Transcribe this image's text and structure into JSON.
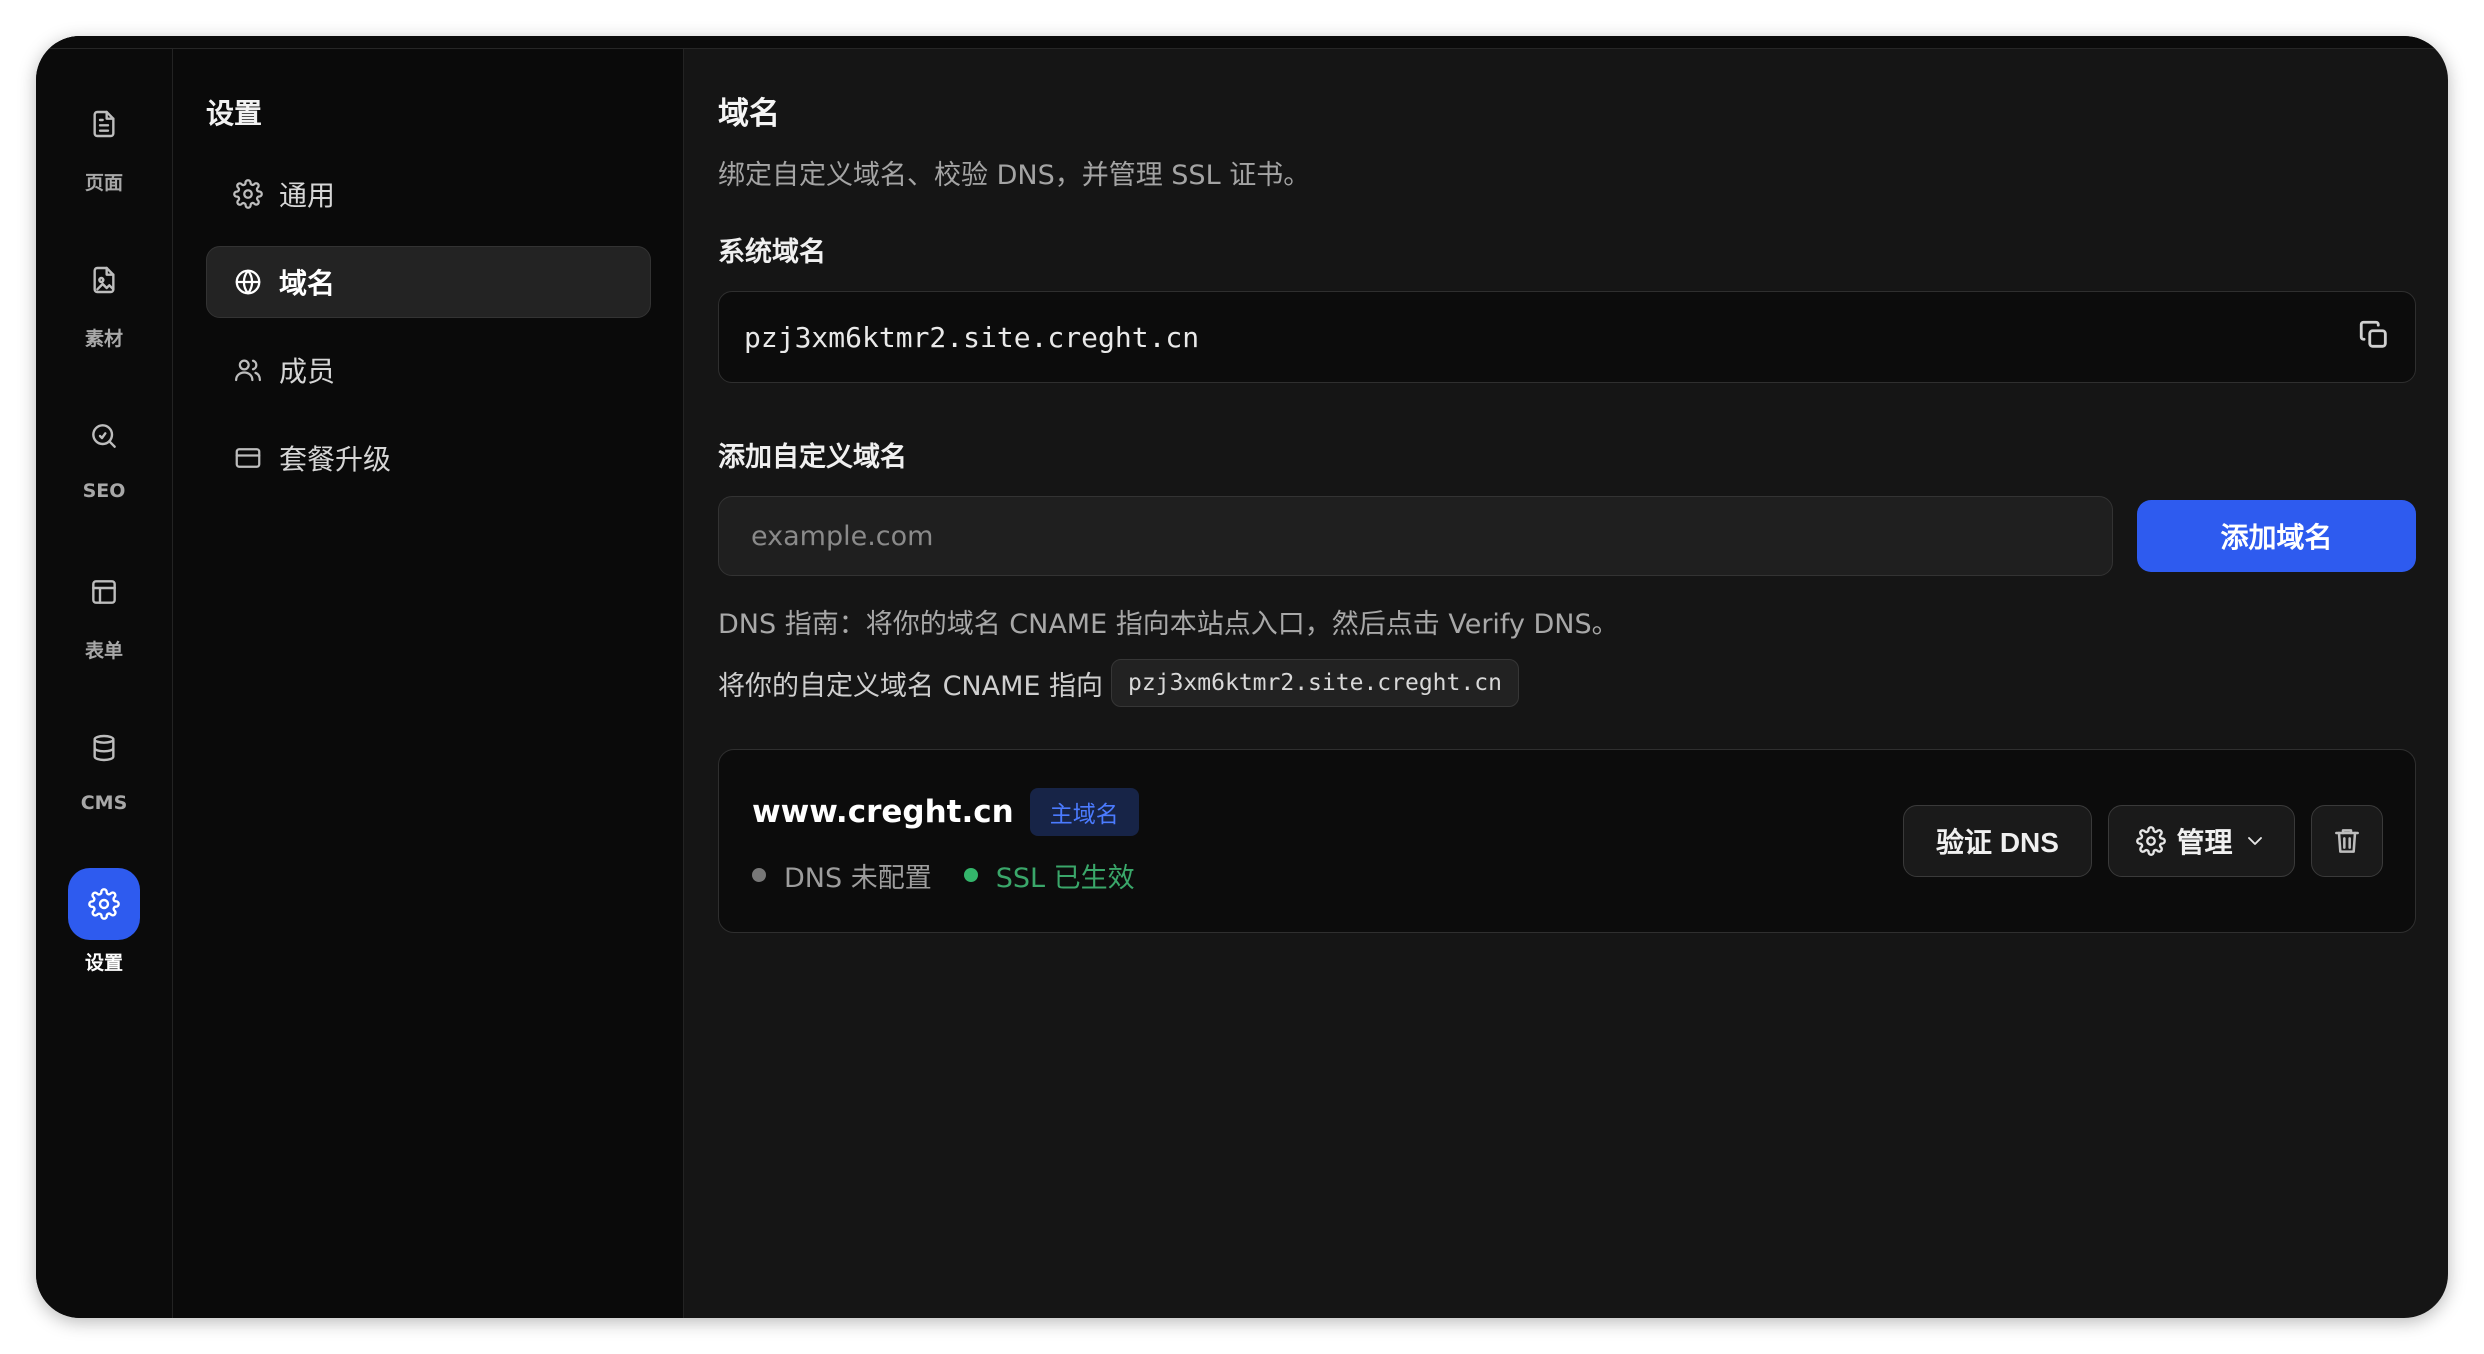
{
  "rail": {
    "items": [
      {
        "label": "页面",
        "icon": "page-icon"
      },
      {
        "label": "素材",
        "icon": "asset-icon"
      },
      {
        "label": "SEO",
        "icon": "seo-icon"
      },
      {
        "label": "表单",
        "icon": "form-icon"
      },
      {
        "label": "CMS",
        "icon": "database-icon"
      },
      {
        "label": "设置",
        "icon": "gear-icon",
        "active": true
      }
    ]
  },
  "nav": {
    "title": "设置",
    "items": [
      {
        "label": "通用",
        "icon": "gear-icon"
      },
      {
        "label": "域名",
        "icon": "globe-icon",
        "active": true
      },
      {
        "label": "成员",
        "icon": "users-icon"
      },
      {
        "label": "套餐升级",
        "icon": "card-icon"
      }
    ]
  },
  "main": {
    "title": "域名",
    "description": "绑定自定义域名、校验 DNS，并管理 SSL 证书。",
    "system_domain": {
      "label": "系统域名",
      "value": "pzj3xm6ktmr2.site.creght.cn"
    },
    "add_domain": {
      "label": "添加自定义域名",
      "placeholder": "example.com",
      "value": "",
      "button": "添加域名"
    },
    "guide": "DNS 指南：将你的域名 CNAME 指向本站点入口，然后点击 Verify DNS。",
    "cname_prefix": "将你的自定义域名 CNAME 指向",
    "cname_target": "pzj3xm6ktmr2.site.creght.cn",
    "domains": [
      {
        "domain": "www.creght.cn",
        "badge": "主域名",
        "dns_status": "DNS 未配置",
        "ssl_status": "SSL 已生效",
        "verify_label": "验证 DNS",
        "manage_label": "管理"
      }
    ]
  },
  "colors": {
    "accent": "#2e5bef",
    "success": "#3aa76a",
    "badge_text": "#4b7bff"
  }
}
